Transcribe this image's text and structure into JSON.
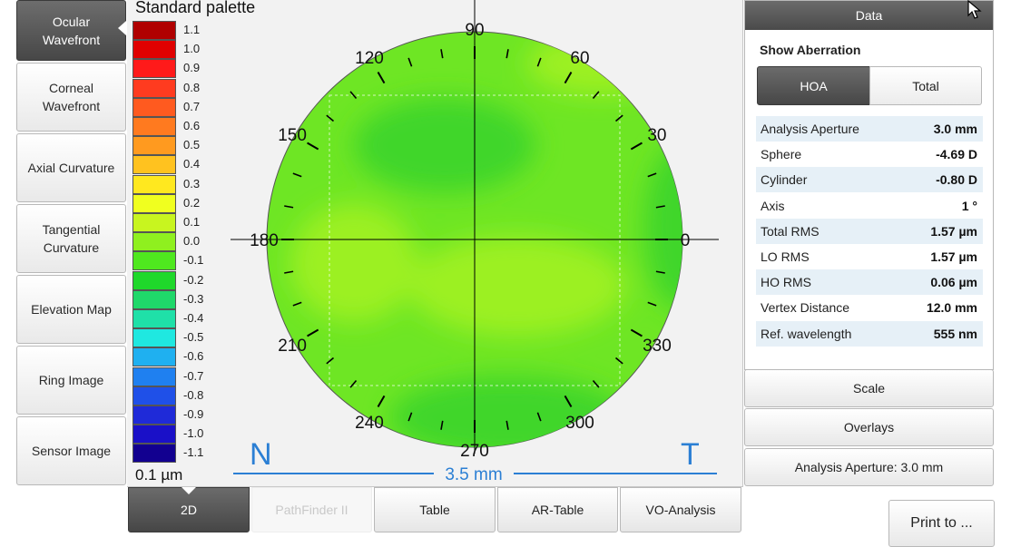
{
  "nav": [
    {
      "label": "Ocular\nWavefront",
      "active": true
    },
    {
      "label": "Corneal\nWavefront"
    },
    {
      "label": "Axial Curvature"
    },
    {
      "label": "Tangential\nCurvature"
    },
    {
      "label": "Elevation Map"
    },
    {
      "label": "Ring Image"
    },
    {
      "label": "Sensor Image"
    }
  ],
  "palette": {
    "title": "Standard palette",
    "unit": "0.1 µm",
    "levels": [
      "1.1",
      "1.0",
      "0.9",
      "0.8",
      "0.7",
      "0.6",
      "0.5",
      "0.4",
      "0.3",
      "0.2",
      "0.1",
      "0.0",
      "-0.1",
      "-0.2",
      "-0.3",
      "-0.4",
      "-0.5",
      "-0.6",
      "-0.7",
      "-0.8",
      "-0.9",
      "-1.0",
      "-1.1"
    ],
    "colors": [
      "#b00000",
      "#e00000",
      "#ff1a1a",
      "#ff3b1f",
      "#ff5a1f",
      "#ff7a1f",
      "#ff9a1f",
      "#ffc21f",
      "#ffe81f",
      "#f0ff1f",
      "#c8f51f",
      "#8ff01f",
      "#4fe81f",
      "#1fd82b",
      "#1fd86a",
      "#1fe0a8",
      "#1fe8e0",
      "#1fb0f0",
      "#1f80f0",
      "#1f50e8",
      "#1f2ad8",
      "#1a10c8",
      "#120090"
    ]
  },
  "map": {
    "angles": [
      "90",
      "60",
      "30",
      "0",
      "330",
      "300",
      "270",
      "240",
      "210",
      "180",
      "150",
      "120"
    ],
    "nasal": "N",
    "temporal": "T",
    "scale": "3.5 mm",
    "colors": {
      "base": "#6ee624",
      "light": "#9cf020",
      "dark": "#3fd62a",
      "frame": "#000000",
      "scale": "#2b7fd4"
    }
  },
  "tabs": [
    {
      "label": "2D",
      "active": true
    },
    {
      "label": "PathFinder II",
      "disabled": true
    },
    {
      "label": "Table"
    },
    {
      "label": "AR-Table"
    },
    {
      "label": "VO-Analysis"
    }
  ],
  "data_panel": {
    "header": "Data",
    "show_aberration": "Show Aberration",
    "hoa": "HOA",
    "total": "Total",
    "rows": [
      {
        "label": "Analysis Aperture",
        "value": "3.0 mm"
      },
      {
        "label": "Sphere",
        "value": "-4.69 D"
      },
      {
        "label": "Cylinder",
        "value": "-0.80 D"
      },
      {
        "label": "Axis",
        "value": "1 °"
      },
      {
        "label": "Total RMS",
        "value": "1.57 µm"
      },
      {
        "label": "LO RMS",
        "value": "1.57 µm"
      },
      {
        "label": "HO RMS",
        "value": "0.06 µm"
      },
      {
        "label": "Vertex Distance",
        "value": "12.0 mm"
      },
      {
        "label": "Ref. wavelength",
        "value": "555 nm"
      }
    ]
  },
  "right_buttons": {
    "scale": "Scale",
    "overlays": "Overlays",
    "aperture": "Analysis Aperture: 3.0 mm",
    "print": "Print to ..."
  }
}
